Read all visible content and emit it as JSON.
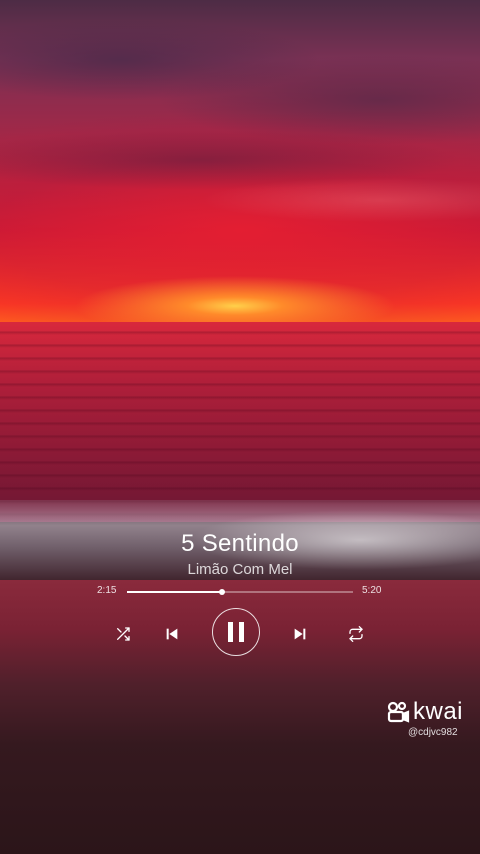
{
  "player": {
    "title": "5 Sentindo",
    "artist": "Limão Com Mel",
    "current_time": "2:15",
    "duration": "5:20",
    "progress_fraction": 0.42,
    "is_playing": true,
    "controls": {
      "shuffle_icon": "shuffle-icon",
      "previous_icon": "skip-previous-icon",
      "pause_icon": "pause-icon",
      "next_icon": "skip-next-icon",
      "repeat_icon": "repeat-icon"
    }
  },
  "watermark": {
    "brand": "kwai",
    "brand_icon": "kwai-logo",
    "handle": "@cdjvc982"
  },
  "colors": {
    "text": "#ffffff",
    "sunset_red": "#d41d32",
    "sun_glow": "#ffd04a"
  }
}
